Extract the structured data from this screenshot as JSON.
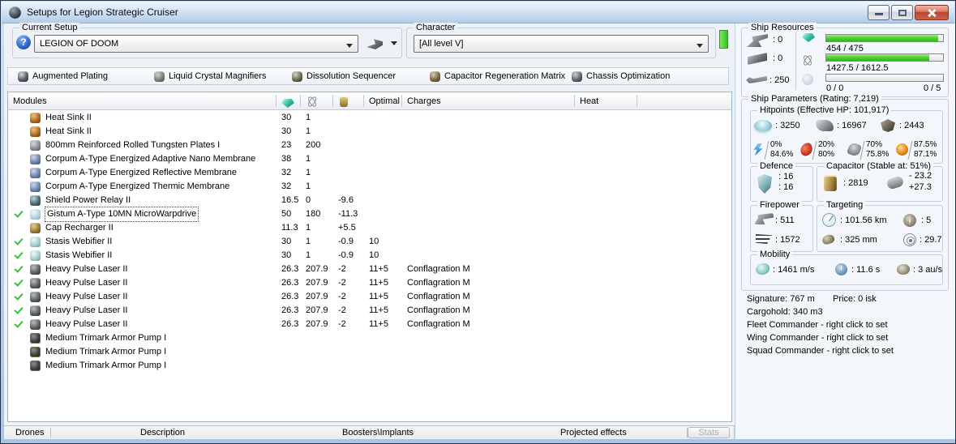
{
  "window": {
    "title": "Setups for Legion Strategic Cruiser"
  },
  "current_setup": {
    "label": "Current Setup",
    "value": "LEGION OF DOOM"
  },
  "character": {
    "label": "Character",
    "value": "[All level V]"
  },
  "subsystems": [
    {
      "label": "Augmented Plating",
      "icon": "subsystem-defensive-icon"
    },
    {
      "label": "Liquid Crystal Magnifiers",
      "icon": "subsystem-offensive-icon"
    },
    {
      "label": "Dissolution Sequencer",
      "icon": "subsystem-core-icon"
    },
    {
      "label": "Capacitor Regeneration Matrix",
      "icon": "subsystem-engineering-icon"
    },
    {
      "label": "Chassis Optimization",
      "icon": "subsystem-propulsion-icon"
    }
  ],
  "modules_table": {
    "headers": {
      "modules": "Modules",
      "optimal": "Optimal",
      "charges": "Charges",
      "heat": "Heat"
    },
    "rows": [
      {
        "checked": false,
        "selected": false,
        "icon": "heat-sink-icon",
        "name": "Heat Sink II",
        "cpu": "30",
        "pg": "1",
        "cap": "",
        "optimal": "",
        "charge": ""
      },
      {
        "checked": false,
        "selected": false,
        "icon": "heat-sink-icon",
        "name": "Heat Sink II",
        "cpu": "30",
        "pg": "1",
        "cap": "",
        "optimal": "",
        "charge": ""
      },
      {
        "checked": false,
        "selected": false,
        "icon": "armor-plate-icon",
        "name": "800mm Reinforced Rolled Tungsten Plates I",
        "cpu": "23",
        "pg": "200",
        "cap": "",
        "optimal": "",
        "charge": ""
      },
      {
        "checked": false,
        "selected": false,
        "icon": "membrane-icon",
        "name": "Corpum A-Type Energized Adaptive Nano Membrane",
        "cpu": "38",
        "pg": "1",
        "cap": "",
        "optimal": "",
        "charge": ""
      },
      {
        "checked": false,
        "selected": false,
        "icon": "membrane-icon",
        "name": "Corpum A-Type Energized Reflective Membrane",
        "cpu": "32",
        "pg": "1",
        "cap": "",
        "optimal": "",
        "charge": ""
      },
      {
        "checked": false,
        "selected": false,
        "icon": "membrane-icon",
        "name": "Corpum A-Type Energized Thermic Membrane",
        "cpu": "32",
        "pg": "1",
        "cap": "",
        "optimal": "",
        "charge": ""
      },
      {
        "checked": false,
        "selected": false,
        "icon": "shield-relay-icon",
        "name": "Shield Power Relay II",
        "cpu": "16.5",
        "pg": "0",
        "cap": "-9.6",
        "optimal": "",
        "charge": ""
      },
      {
        "checked": true,
        "selected": true,
        "icon": "mwd-icon",
        "name": "Gistum A-Type 10MN MicroWarpdrive",
        "cpu": "50",
        "pg": "180",
        "cap": "-11.3",
        "optimal": "",
        "charge": ""
      },
      {
        "checked": false,
        "selected": false,
        "icon": "cap-recharger-icon",
        "name": "Cap Recharger II",
        "cpu": "11.3",
        "pg": "1",
        "cap": "+5.5",
        "optimal": "",
        "charge": ""
      },
      {
        "checked": true,
        "selected": false,
        "icon": "webifier-icon",
        "name": "Stasis Webifier II",
        "cpu": "30",
        "pg": "1",
        "cap": "-0.9",
        "optimal": "10",
        "charge": ""
      },
      {
        "checked": true,
        "selected": false,
        "icon": "webifier-icon",
        "name": "Stasis Webifier II",
        "cpu": "30",
        "pg": "1",
        "cap": "-0.9",
        "optimal": "10",
        "charge": ""
      },
      {
        "checked": true,
        "selected": false,
        "icon": "laser-icon",
        "name": "Heavy Pulse Laser II",
        "cpu": "26.3",
        "pg": "207.9",
        "cap": "-2",
        "optimal": "11+5",
        "charge": "Conflagration M"
      },
      {
        "checked": true,
        "selected": false,
        "icon": "laser-icon",
        "name": "Heavy Pulse Laser II",
        "cpu": "26.3",
        "pg": "207.9",
        "cap": "-2",
        "optimal": "11+5",
        "charge": "Conflagration M"
      },
      {
        "checked": true,
        "selected": false,
        "icon": "laser-icon",
        "name": "Heavy Pulse Laser II",
        "cpu": "26.3",
        "pg": "207.9",
        "cap": "-2",
        "optimal": "11+5",
        "charge": "Conflagration M"
      },
      {
        "checked": true,
        "selected": false,
        "icon": "laser-icon",
        "name": "Heavy Pulse Laser II",
        "cpu": "26.3",
        "pg": "207.9",
        "cap": "-2",
        "optimal": "11+5",
        "charge": "Conflagration M"
      },
      {
        "checked": true,
        "selected": false,
        "icon": "laser-icon",
        "name": "Heavy Pulse Laser II",
        "cpu": "26.3",
        "pg": "207.9",
        "cap": "-2",
        "optimal": "11+5",
        "charge": "Conflagration M"
      },
      {
        "checked": false,
        "selected": false,
        "icon": "rig-icon",
        "name": "Medium Trimark Armor Pump I",
        "cpu": "",
        "pg": "",
        "cap": "",
        "optimal": "",
        "charge": ""
      },
      {
        "checked": false,
        "selected": false,
        "icon": "rig-icon",
        "name": "Medium Trimark Armor Pump I",
        "cpu": "",
        "pg": "",
        "cap": "",
        "optimal": "",
        "charge": ""
      },
      {
        "checked": false,
        "selected": false,
        "icon": "rig-icon",
        "name": "Medium Trimark Armor Pump I",
        "cpu": "",
        "pg": "",
        "cap": "",
        "optimal": "",
        "charge": ""
      }
    ]
  },
  "bottom_bar": {
    "sections": [
      "Drones",
      "Description",
      "Boosters\\Implants",
      "Projected effects"
    ],
    "stats_button": "Stats"
  },
  "ship_resources": {
    "label": "Ship Resources",
    "turrets": ": 0",
    "launchers": ": 0",
    "calibration": ": 250",
    "cpu": {
      "text": "454 / 475",
      "percent": 95.6
    },
    "powergrid": {
      "text": "1427.5 / 1612.5",
      "percent": 88.5
    },
    "drones": {
      "left": "0 / 0",
      "right": "0 / 5",
      "percent": 0
    }
  },
  "ship_parameters": {
    "label": "Ship Parameters (Rating: 7,219)",
    "hitpoints": {
      "label": "Hitpoints (Effective HP: 101,917)",
      "shield": ": 3250",
      "armor": ": 16967",
      "hull": ": 2443",
      "resists": [
        {
          "icon": "em-resist-icon",
          "top": "0%",
          "bottom": "84.6%"
        },
        {
          "icon": "thermal-resist-icon",
          "top": "20%",
          "bottom": "80%"
        },
        {
          "icon": "kinetic-resist-icon",
          "top": "70%",
          "bottom": "75.8%"
        },
        {
          "icon": "explosive-resist-icon",
          "top": "87.5%",
          "bottom": "87.1%"
        }
      ]
    },
    "defence": {
      "label": "Defence",
      "top": ": 16",
      "bottom": ": 16"
    },
    "capacitor": {
      "label": "Capacitor (Stable at: 51%)",
      "amount": ": 2819",
      "delta_top": "- 23.2",
      "delta_bottom": "+27.3"
    },
    "firepower": {
      "label": "Firepower",
      "dps": ": 511",
      "volley": ": 1572"
    },
    "targeting": {
      "label": "Targeting",
      "range": ": 101.56 km",
      "max_targets": ": 5",
      "scan_res": ": 325 mm",
      "sensor_strength": ": 29.7"
    },
    "mobility": {
      "label": "Mobility",
      "speed": ": 1461 m/s",
      "align": ": 11.6 s",
      "warp": ": 3 au/s"
    },
    "signature": "Signature: 767 m",
    "price": "Price: 0 isk",
    "cargohold": "Cargohold: 340 m3",
    "fleet": "Fleet Commander - right click to set",
    "wing": "Wing Commander - right click to set",
    "squad": "Squad Commander - right click to set"
  },
  "colors": {
    "bar_green": "#52d434",
    "char_bar_green": "#2fc61b",
    "check_green": "#35c235",
    "close_red": "#bb4630"
  }
}
